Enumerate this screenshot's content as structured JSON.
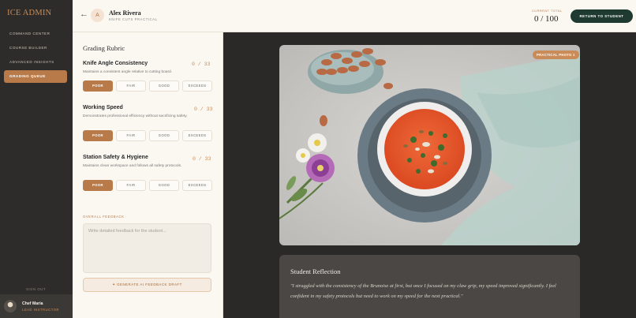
{
  "sidebar": {
    "brand": "ICE ADMIN",
    "items": [
      {
        "label": "COMMAND CENTER"
      },
      {
        "label": "COURSE BUILDER"
      },
      {
        "label": "ADVANCED INSIGHTS"
      },
      {
        "label": "GRADING QUEUE"
      }
    ],
    "signout": "SIGN OUT",
    "user": {
      "name": "Chef Maria",
      "role": "LEAD INSTRUCTOR"
    }
  },
  "header": {
    "back_icon": "arrow-left-icon",
    "avatar_initial": "A",
    "student_name": "Alex Rivera",
    "student_sub": "KNIFE CUTS PRACTICAL",
    "total_label": "CURRENT TOTAL",
    "total_value": "0 / 100",
    "return_label": "RETURN TO STUDENT"
  },
  "rubric": {
    "title": "Grading Rubric",
    "levels": [
      "POOR",
      "FAIR",
      "GOOD",
      "EXCEEDS"
    ],
    "criteria": [
      {
        "title": "Knife Angle Consistency",
        "desc": "Maintains a consistent angle relative to cutting board.",
        "score": "0 / 33",
        "selected": "POOR"
      },
      {
        "title": "Working Speed",
        "desc": "Demonstrates professional efficiency without sacrificing safety.",
        "score": "0 / 33",
        "selected": "POOR"
      },
      {
        "title": "Station Safety & Hygiene",
        "desc": "Maintains clean workspace and follows all safety protocols.",
        "score": "0 / 33",
        "selected": "POOR"
      }
    ],
    "feedback_label": "OVERALL FEEDBACK",
    "feedback_placeholder": "Write detailed feedback for the student...",
    "generate_label": "GENERATE AI FEEDBACK DRAFT"
  },
  "photo": {
    "tag": "PRACTICAL PHOTO 1"
  },
  "reflection": {
    "title": "Student Reflection",
    "text": "\"I struggled with the consistency of the Brunoise at first, but once I focused on my claw grip, my speed improved significantly. I feel confident in my safety protocols but need to work on my speed for the next practical.\""
  },
  "colors": {
    "accent": "#b87a48",
    "dark_green": "#1f3a30",
    "sidebar": "#2d2c2a"
  }
}
